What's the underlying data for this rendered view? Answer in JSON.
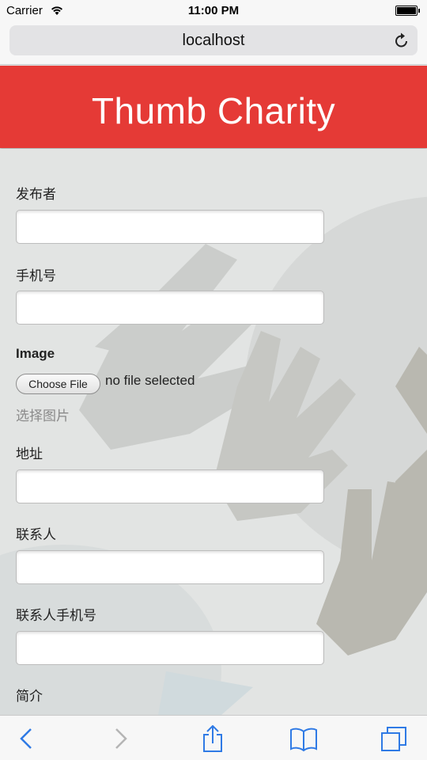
{
  "status_bar": {
    "carrier": "Carrier",
    "time": "11:00 PM",
    "icons": [
      "wifi-icon",
      "battery-icon"
    ]
  },
  "browser": {
    "url": "localhost",
    "icons": [
      "reload-icon"
    ]
  },
  "header": {
    "title": "Thumb Charity",
    "background_color": "#e53a36"
  },
  "form": {
    "publisher_label": "发布者",
    "phone_label": "手机号",
    "image_label": "Image",
    "choose_file_label": "Choose File",
    "file_status": "no file selected",
    "image_hint": "选择图片",
    "address_label": "地址",
    "contact_label": "联系人",
    "contact_phone_label": "联系人手机号",
    "intro_label": "简介",
    "publisher_value": "",
    "phone_value": "",
    "address_value": "",
    "contact_value": "",
    "contact_phone_value": ""
  },
  "toolbar": {
    "icons": [
      "back-icon",
      "forward-icon",
      "share-icon",
      "bookmarks-icon",
      "tabs-icon"
    ],
    "accent_color": "#2f7ae5"
  }
}
